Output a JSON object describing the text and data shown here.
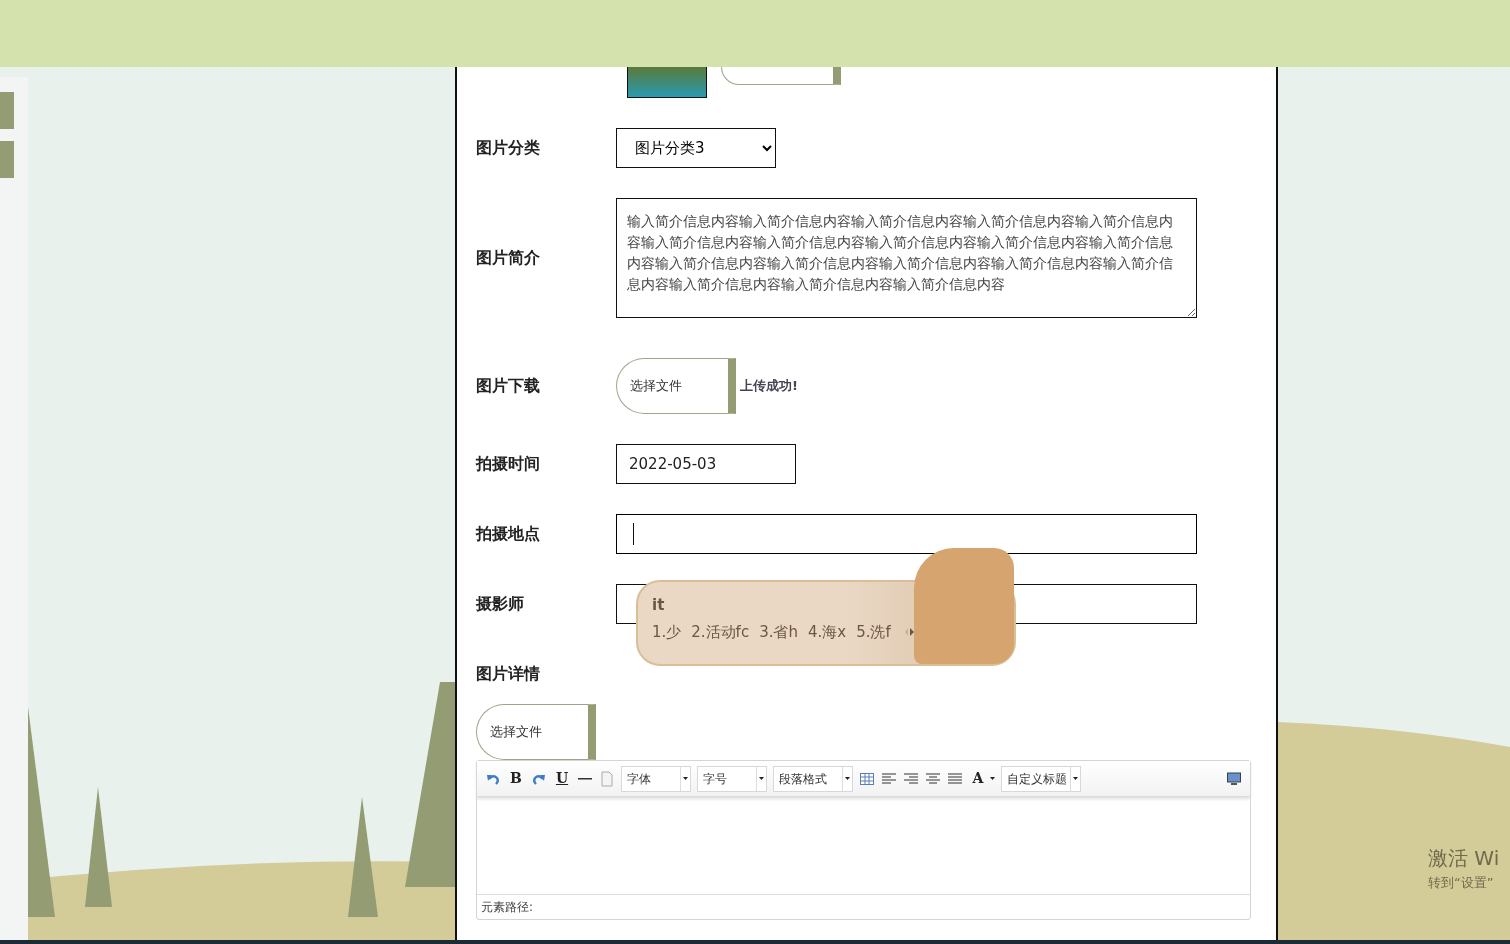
{
  "fields": [
    {
      "kind": "select",
      "label": "图片分类",
      "value": "图片分类3"
    },
    {
      "kind": "textarea",
      "label": "图片简介",
      "value": "输入简介信息内容输入简介信息内容输入简介信息内容输入简介信息内容输入简介信息内容输入简介信息内容输入简介信息内容输入简介信息内容输入简介信息内容输入简介信息内容输入简介信息内容输入简介信息内容输入简介信息内容输入简介信息内容输入简介信息内容输入简介信息内容输入简介信息内容输入简介信息内容"
    },
    {
      "kind": "file",
      "label": "图片下载",
      "button": "选择文件",
      "status": "上传成功!"
    },
    {
      "kind": "date",
      "label": "拍摄时间",
      "value": "2022-05-03"
    },
    {
      "kind": "text",
      "label": "拍摄地点",
      "focused": true
    },
    {
      "kind": "text",
      "label": "摄影师",
      "focused": false
    },
    {
      "kind": "heading",
      "label": "图片详情"
    }
  ],
  "detail_upload": {
    "button": "选择文件"
  },
  "editor": {
    "toolbar": [
      {
        "kind": "undo"
      },
      {
        "kind": "glyph",
        "label": "B"
      },
      {
        "kind": "redo"
      },
      {
        "kind": "glyph",
        "label": "U",
        "underline": true
      },
      {
        "kind": "hr"
      },
      {
        "kind": "page"
      },
      {
        "kind": "select",
        "label": "字体"
      },
      {
        "kind": "select",
        "label": "字号"
      },
      {
        "kind": "select",
        "label": "段落格式"
      },
      {
        "kind": "table"
      },
      {
        "kind": "align-left"
      },
      {
        "kind": "align-right"
      },
      {
        "kind": "align-center"
      },
      {
        "kind": "justify"
      },
      {
        "kind": "glyph",
        "label": "A",
        "caret": true
      },
      {
        "kind": "select",
        "label": "自定义标题"
      },
      {
        "kind": "monitor"
      }
    ],
    "path_label": "元素路径:"
  },
  "ime": {
    "input": "it",
    "candidates": [
      "1.少",
      "2.活动fc",
      "3.省h",
      "4.海x",
      "5.洗f"
    ]
  },
  "os_notice": {
    "title": "激活 Wi",
    "subtitle": "转到“设置”"
  }
}
